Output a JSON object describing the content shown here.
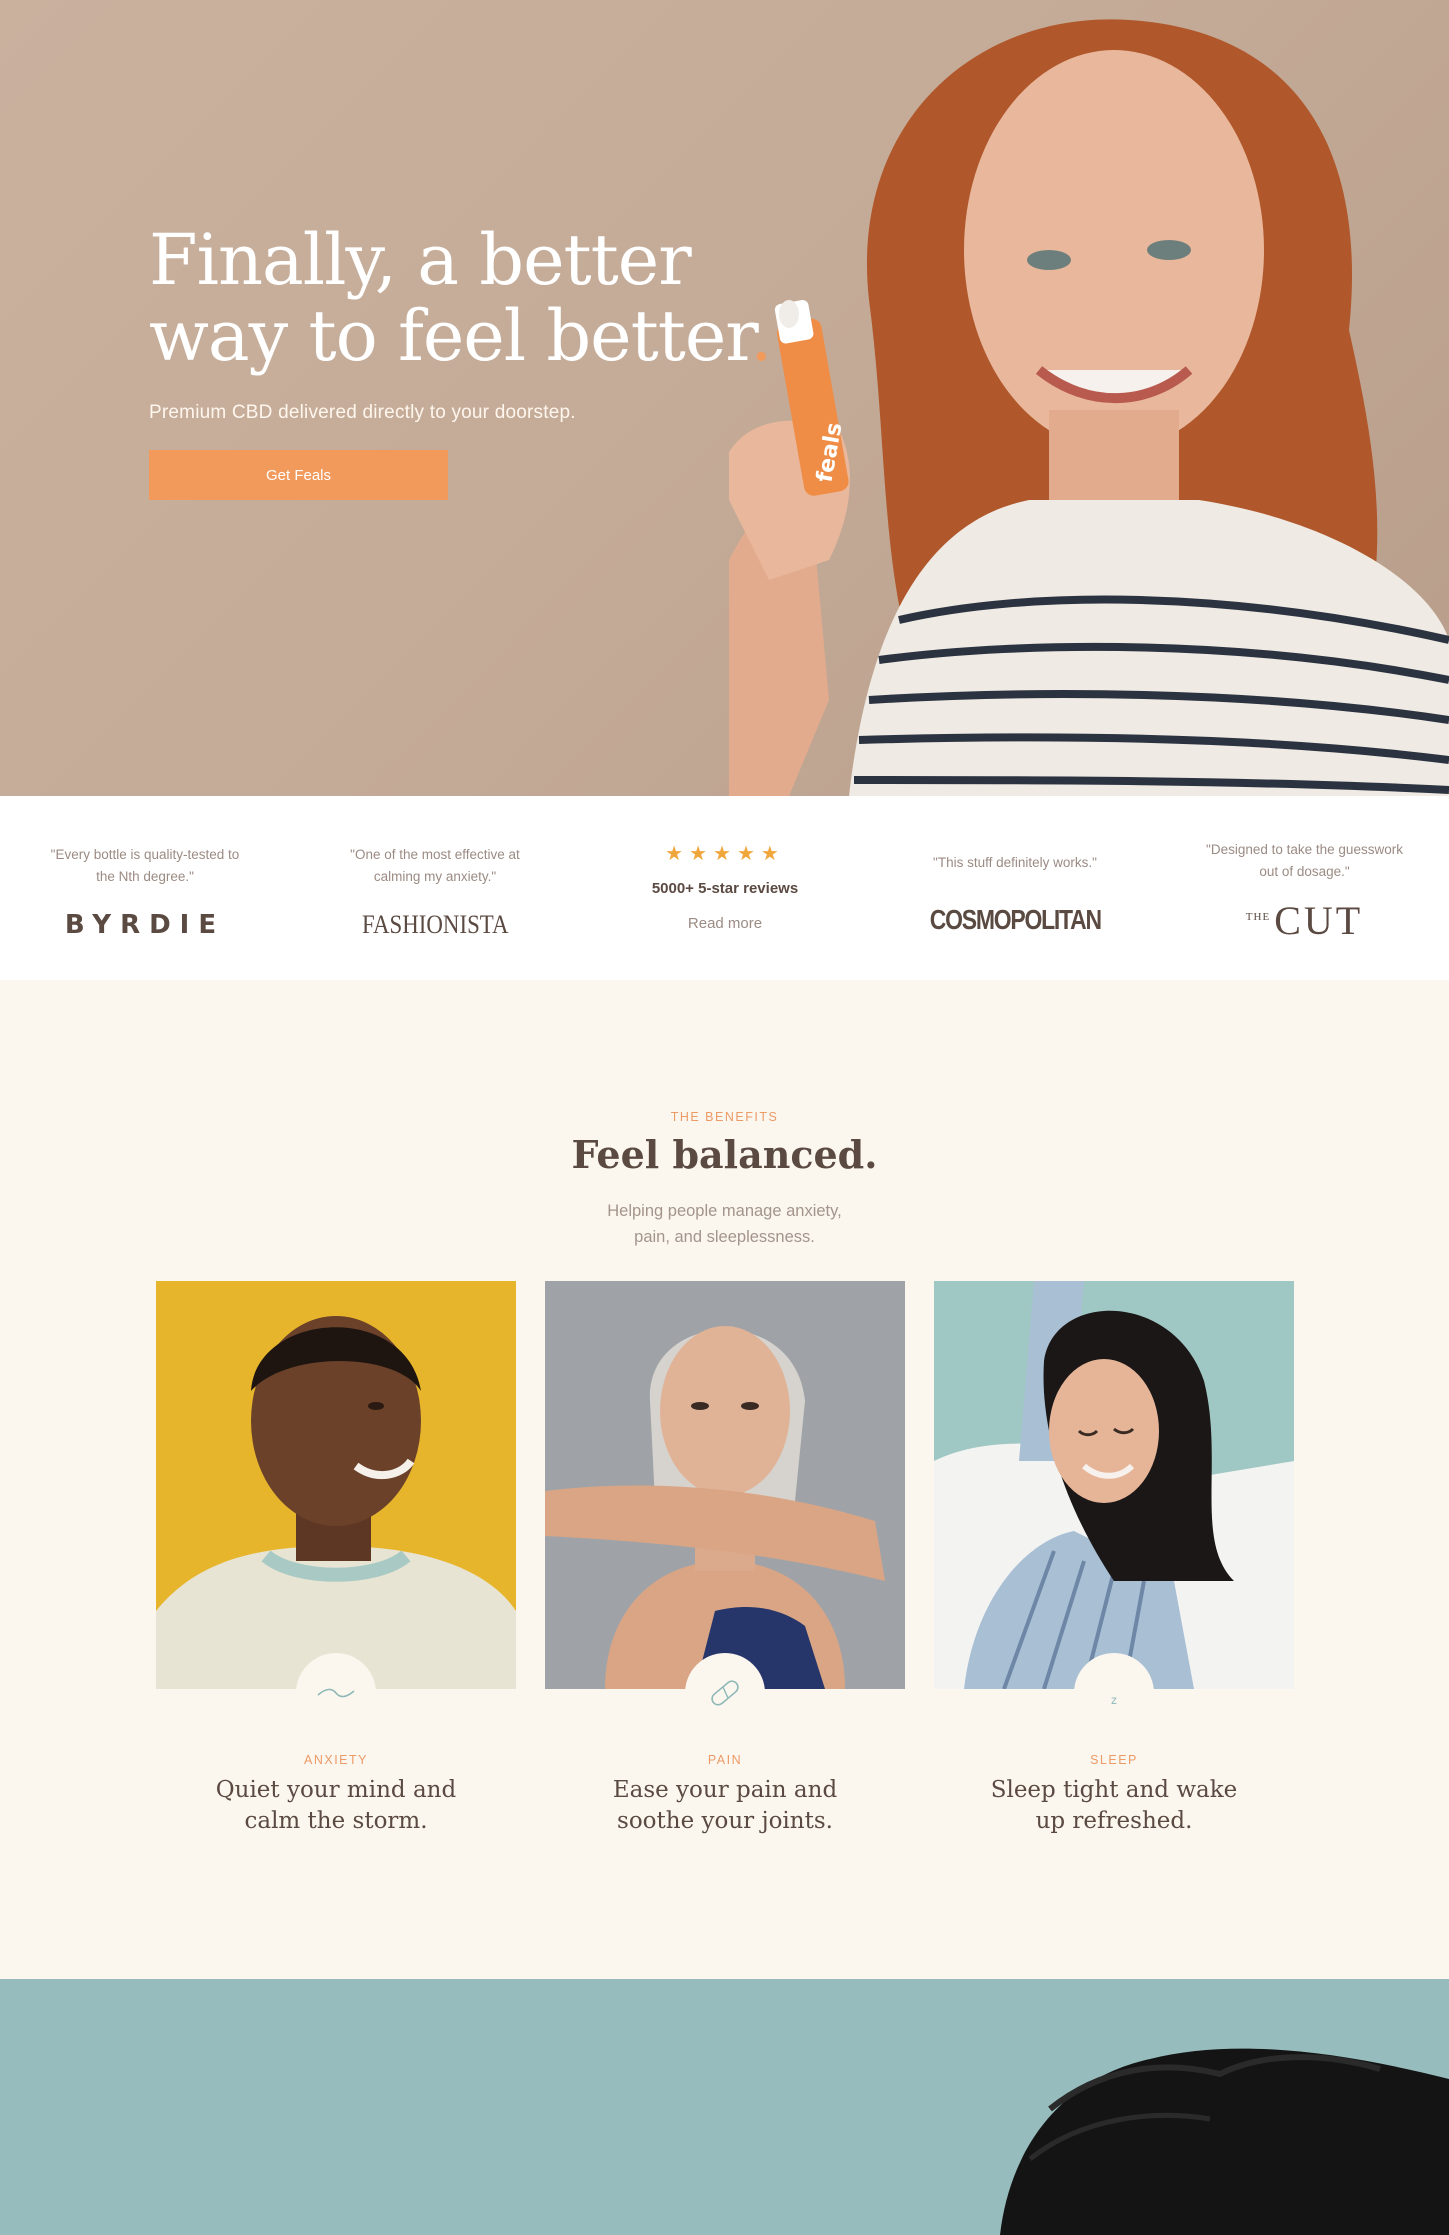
{
  "colors": {
    "accent": "#f2995c",
    "hero_bg": "#c7af9b",
    "text_dark": "#5b4a42",
    "cream": "#fbf7ef",
    "teal": "#97bcbd"
  },
  "hero": {
    "title_line1": "Finally, a better",
    "title_line2": "way to feel better",
    "title_dot": ".",
    "subtitle": "Premium CBD delivered directly to your doorstep.",
    "cta_label": "Get Feals",
    "bottle_label": "feals"
  },
  "press": {
    "items": [
      {
        "quote": "\"Every bottle is quality-tested to the Nth degree.\"",
        "logo": "BYRDIE"
      },
      {
        "quote": "\"One of the most effective at calming my anxiety.\"",
        "logo": "FASHIONISTA"
      },
      {
        "stars": "★★★★★",
        "review_count": "5000+ 5-star reviews",
        "link_label": "Read more"
      },
      {
        "quote": "\"This stuff definitely works.\"",
        "logo": "COSMOPOLITAN"
      },
      {
        "quote": "\"Designed to take the guesswork out of dosage.\"",
        "logo_prefix": "THE",
        "logo": "CUT"
      }
    ]
  },
  "benefits": {
    "eyebrow": "THE BENEFITS",
    "title": "Feel balanced.",
    "description_line1": "Helping people manage anxiety,",
    "description_line2": "pain, and sleeplessness.",
    "cards": [
      {
        "label": "ANXIETY",
        "text": "Quiet your mind and calm the storm.",
        "icon": "wave-icon",
        "photo_bg": "#e7b52c"
      },
      {
        "label": "PAIN",
        "text": "Ease your pain and soothe your joints.",
        "icon": "bandage-icon",
        "photo_bg": "#9fa3a8"
      },
      {
        "label": "SLEEP",
        "text": "Sleep tight and wake up refreshed.",
        "icon": "sleep-z-icon",
        "photo_bg": "#9fc7c4",
        "icon_text": "z"
      }
    ]
  }
}
